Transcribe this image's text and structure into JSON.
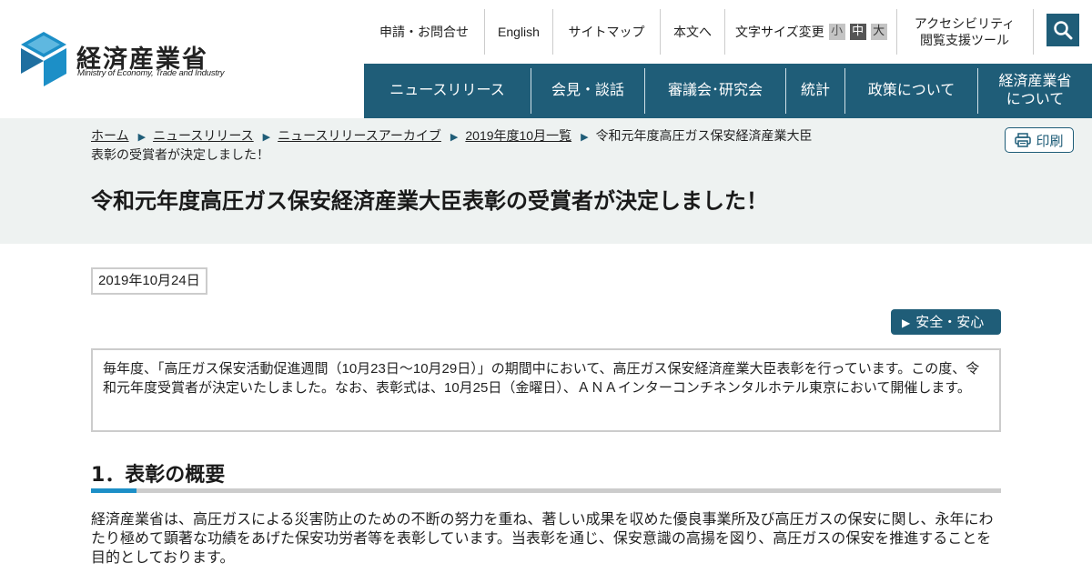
{
  "site": {
    "name": "経済産業省",
    "name_en": "Ministry of Economy, Trade and Industry"
  },
  "utility_nav": {
    "contact": "申請・お問合せ",
    "english": "English",
    "sitemap": "サイトマップ",
    "skip": "本文へ",
    "font_size_label": "文字サイズ変更",
    "font_small": "小",
    "font_medium": "中",
    "font_large": "大",
    "accessibility_line1": "アクセシビリティ",
    "accessibility_line2": "閲覧支援ツール"
  },
  "global_nav": [
    {
      "label": "ニュースリリース"
    },
    {
      "label": "会見・談話"
    },
    {
      "label": "審議会･研究会"
    },
    {
      "label": "統計"
    },
    {
      "label": "政策について"
    },
    {
      "label": "経済産業省\nについて"
    }
  ],
  "breadcrumb": [
    {
      "label": "ホーム"
    },
    {
      "label": "ニュースリリース"
    },
    {
      "label": "ニュースリリースアーカイブ"
    },
    {
      "label": "2019年度10月一覧"
    }
  ],
  "breadcrumb_current": "令和元年度高圧ガス保安経済産業大臣表彰の受賞者が決定しました！",
  "print_label": "印刷",
  "page_title": "令和元年度高圧ガス保安経済産業大臣表彰の受賞者が決定しました！",
  "date": "2019年10月24日",
  "category_tag": "安全・安心",
  "lead": "毎年度、「高圧ガス保安活動促進週間（10月23日～10月29日）」の期間中において、高圧ガス保安経済産業大臣表彰を行っています。この度、令和元年度受賞者が決定いたしました。なお、表彰式は、10月25日（金曜日）、ＡＮＡインターコンチネンタルホテル東京において開催します。",
  "section1": {
    "heading": "1．表彰の概要",
    "text": "経済産業省は、高圧ガスによる災害防止のための不断の努力を重ね、著しい成果を収めた優良事業所及び高圧ガスの保安に関し、永年にわたり極めて顕著な功績をあげた保安功労者等を表彰しています。当表彰を通じ、保安意識の高揚を図り、高圧ガスの保安を推進することを目的としております。"
  },
  "colors": {
    "brand": "#1f5d78",
    "accent": "#1c8fc7",
    "band": "#eef2f1"
  }
}
